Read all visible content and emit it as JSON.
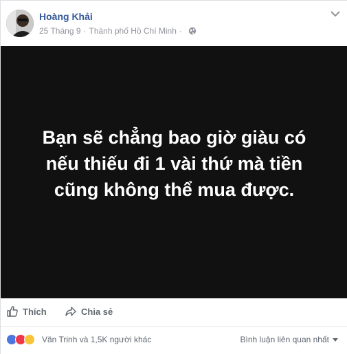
{
  "post": {
    "author": "Hoàng Khải",
    "date": "25 Tháng 9",
    "separator": "·",
    "location": "Thành phố Hồ Chí Minh",
    "privacy_icon": "globe-icon",
    "more_icon": "chevron-down-icon"
  },
  "image": {
    "background_color": "#111111",
    "text_color": "#ffffff",
    "quote_lines": [
      "Bạn sẽ chẳng bao giờ giàu có",
      "nếu thiếu đi 1 vài thứ mà tiền",
      "cũng không thể mua được."
    ]
  },
  "actions": {
    "like_label": "Thích",
    "like_icon": "thumbs-up-icon",
    "share_label": "Chia sẻ",
    "share_icon": "share-arrow-icon"
  },
  "reactions": {
    "icons": [
      "like-reaction-icon",
      "love-reaction-icon",
      "haha-reaction-icon"
    ],
    "colors": {
      "like": "#4a78e0",
      "love": "#f0384c",
      "haha": "#f7c43a"
    },
    "summary": "Văn Trinh và 1,5K người khác",
    "comment_sort": "Bình luận liên quan nhất"
  },
  "colors": {
    "author_link": "#365899",
    "meta_text": "#90949c",
    "action_text": "#606770"
  }
}
